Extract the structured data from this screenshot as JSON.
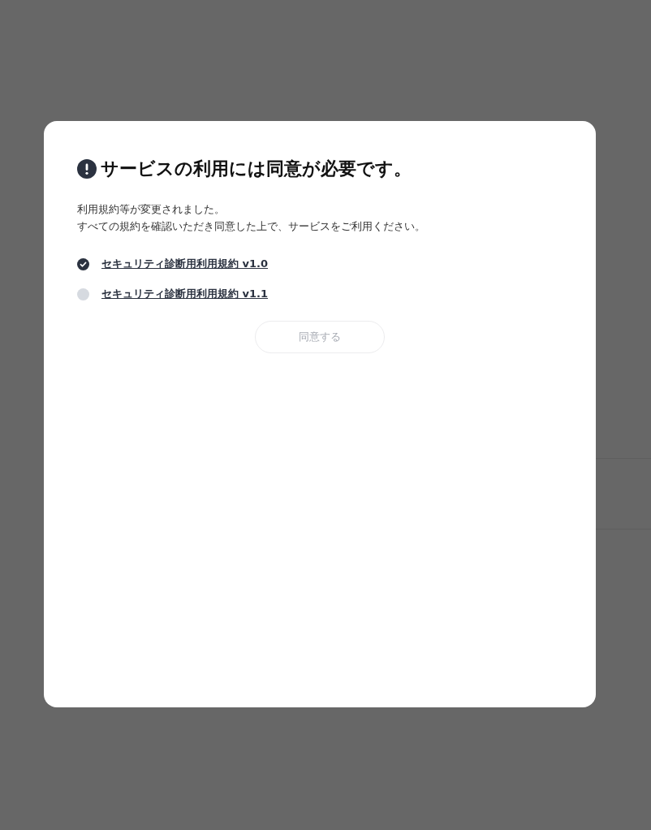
{
  "dialog": {
    "title": "サービスの利用には同意が必要です。",
    "message": [
      "利用規約等が変更されました。",
      "すべての規約を確認いただき同意した上で、サービスをご利用ください。"
    ],
    "terms": [
      {
        "label": "セキュリティ診断用利用規約 v1.0",
        "checked": true
      },
      {
        "label": "セキュリティ診断用利用規約 v1.1",
        "checked": false
      }
    ],
    "agree_button": {
      "label": "同意する",
      "disabled": true
    }
  }
}
